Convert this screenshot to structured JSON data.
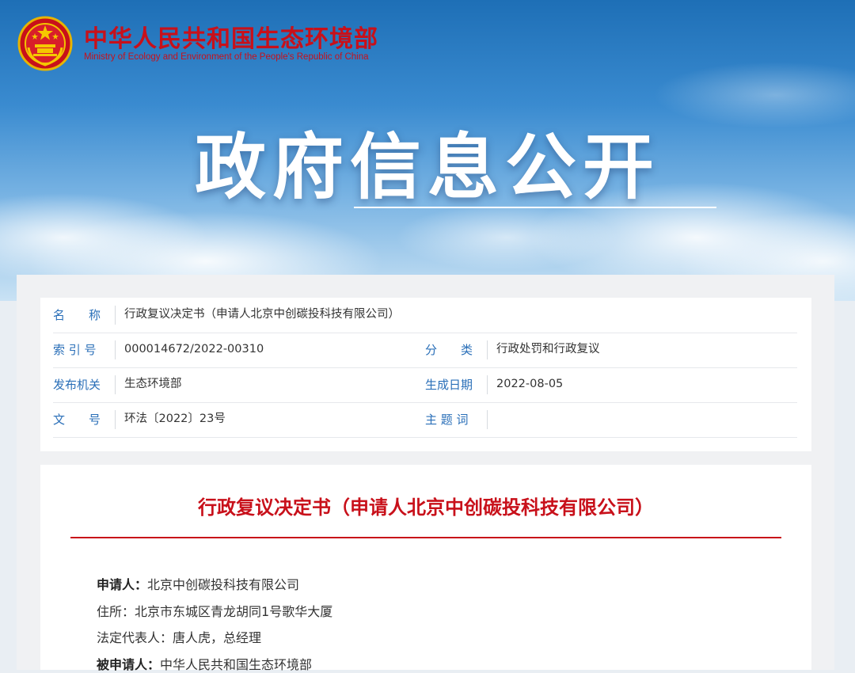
{
  "header": {
    "ministry_name_cn": "中华人民共和国生态环境部",
    "ministry_name_en": "Ministry of Ecology and Environment of the People's Republic of China",
    "hero_title": "政府信息公开",
    "logo_icon": "national-emblem-icon"
  },
  "info": {
    "name_label": "名　　称",
    "name_value": "行政复议决定书（申请人北京中创碳投科技有限公司）",
    "index_label": "索 引 号",
    "index_value": "000014672/2022-00310",
    "category_label": "分　　类",
    "category_value": "行政处罚和行政复议",
    "issuer_label": "发布机关",
    "issuer_value": "生态环境部",
    "date_label": "生成日期",
    "date_value": "2022-08-05",
    "docno_label": "文　　号",
    "docno_value": "环法〔2022〕23号",
    "keywords_label": "主 题 词",
    "keywords_value": ""
  },
  "document": {
    "title": "行政复议决定书（申请人北京中创碳投科技有限公司）",
    "applicant_label": "申请人：",
    "applicant_value": "北京中创碳投科技有限公司",
    "address_label": "住所：",
    "address_value": "北京市东城区青龙胡同1号歌华大厦",
    "rep_label": "法定代表人：",
    "rep_value": "唐人虎，总经理",
    "respondent_label": "被申请人：",
    "respondent_value": "中华人民共和国生态环境部"
  },
  "colors": {
    "brand_red": "#c8101a",
    "label_blue": "#2a6fb8"
  }
}
